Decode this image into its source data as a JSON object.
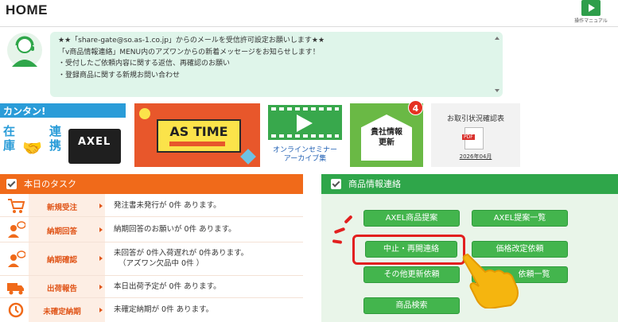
{
  "header": {
    "title": "HOME",
    "manual_label": "操作マニュアル"
  },
  "notice": {
    "lines": [
      "★★「share-gate@so.as-1.co.jp」からのメールを受信許可設定お願いします★★",
      "「v商品情報連絡」MENU内のアズワンからの新着メッセージをお知らせします！",
      "・受付したご依頼内容に関する返信、再確認のお願い",
      "・登録商品に関する新規お問い合わせ"
    ]
  },
  "banners": {
    "axel": {
      "kantan": "カンタン!",
      "zaiko": "在庫",
      "renkei": "連携",
      "brand": "AXEL"
    },
    "astime": {
      "title": "AS TIME"
    },
    "seminar": {
      "caption_1": "オンラインセミナー",
      "caption_2": "アーカイブ集"
    },
    "company": {
      "line_1": "貴社情報",
      "line_2": "更新",
      "badge": "4"
    },
    "report": {
      "title": "お取引状況確認表",
      "file_type": "PDF",
      "date": "2026年04月"
    }
  },
  "tasks": {
    "title": "本日のタスク",
    "rows": [
      {
        "icon": "cart-icon",
        "label": "新規受注",
        "text": "発注書未発行が 0件 あります。"
      },
      {
        "icon": "person-chat-icon",
        "label": "納期回答",
        "text": "納期回答のお願いが 0件 あります。"
      },
      {
        "icon": "person-chat-icon",
        "label": "納期確認",
        "text": "未回答が 0件入荷遅れが 0件あります。",
        "text_2": "（アズワン欠品中 0件 ）"
      },
      {
        "icon": "truck-icon",
        "label": "出荷報告",
        "text": "本日出荷予定が 0件 あります。"
      },
      {
        "icon": "clock-icon",
        "label": "未確定納期",
        "text": "未確定納期が 0件 あります。"
      }
    ]
  },
  "product": {
    "title": "商品情報連絡",
    "buttons": {
      "axel_proposal": "AXEL商品提案",
      "axel_list": "AXEL提案一覧",
      "suspend": "中止・再開連絡",
      "price_change": "価格改定依頼",
      "other_update": "その他更新依頼",
      "request_list": "依頼一覧",
      "search": "商品検索"
    }
  },
  "colors": {
    "orange": "#f06a1a",
    "green": "#2fa64a",
    "button_green": "#43b54d",
    "highlight_red": "#e21f1f"
  }
}
